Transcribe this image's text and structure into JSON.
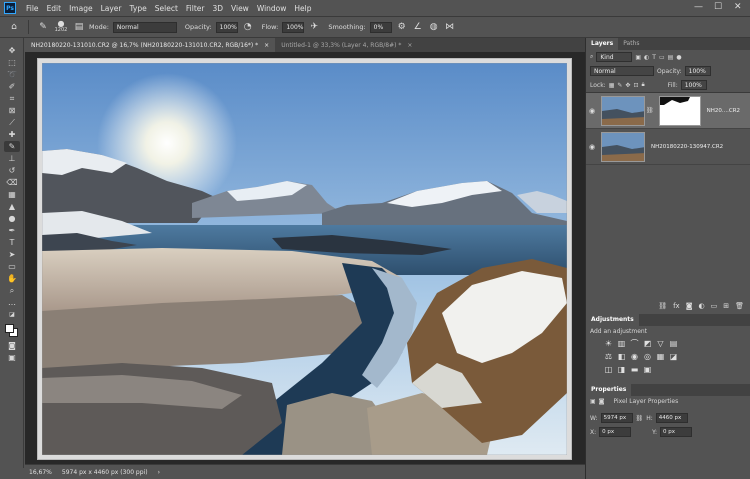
{
  "app": {
    "logo_text": "Ps"
  },
  "menu": [
    "File",
    "Edit",
    "Image",
    "Layer",
    "Type",
    "Select",
    "Filter",
    "3D",
    "View",
    "Window",
    "Help"
  ],
  "window_controls": {
    "minimize": "—",
    "maximize": "☐",
    "close": "✕"
  },
  "options_bar": {
    "brush_size": "1202",
    "mode_label": "Mode:",
    "mode_value": "Normal",
    "opacity_label": "Opacity:",
    "opacity_value": "100%",
    "flow_label": "Flow:",
    "flow_value": "100%",
    "smoothing_label": "Smoothing:",
    "smoothing_value": "0%"
  },
  "doc_tabs": [
    {
      "label": "NH20180220-131010.CR2 @ 16,7% (NH20180220-131010.CR2, RGB/16*) *",
      "close": "×"
    },
    {
      "label": "Untitled-1 @ 33,3% (Layer 4, RGB/8#) *",
      "close": "×"
    }
  ],
  "status": {
    "zoom": "16,67%",
    "doc_info": "5974 px x 4460 px (300 ppi)"
  },
  "layers_panel": {
    "tabs": [
      "Layers",
      "Paths"
    ],
    "filter_value": "Kind",
    "blend_mode": "Normal",
    "opacity_label": "Opacity:",
    "opacity_value": "100%",
    "lock_label": "Lock:",
    "fill_label": "Fill:",
    "fill_value": "100%",
    "layers": [
      {
        "name": "NH20....CR2",
        "has_mask": true,
        "selected": true
      },
      {
        "name": "NH20180220-130947.CR2",
        "has_mask": false,
        "selected": false
      }
    ]
  },
  "adjustments_panel": {
    "title": "Adjustments",
    "hint": "Add an adjustment"
  },
  "properties_panel": {
    "title": "Properties",
    "subtitle": "Pixel Layer Properties",
    "w_label": "W:",
    "w_value": "5974 px",
    "h_label": "H:",
    "h_value": "4460 px",
    "x_label": "X:",
    "x_value": "0 px",
    "y_label": "Y:",
    "y_value": "0 px"
  },
  "colors": {
    "panel": "#535353",
    "dark": "#424242",
    "canvas": "#282828",
    "accent": "#31a8ff"
  }
}
